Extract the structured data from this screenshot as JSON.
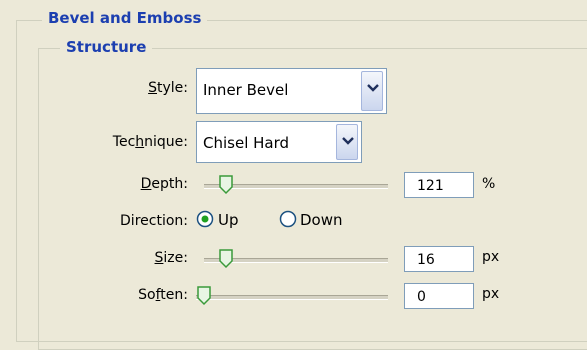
{
  "panel": {
    "title": "Bevel and Emboss",
    "section_title": "Structure"
  },
  "style": {
    "label_pre": "",
    "label_u": "S",
    "label_post": "tyle:",
    "value": "Inner Bevel"
  },
  "technique": {
    "label_pre": "Tec",
    "label_u": "h",
    "label_post": "nique:",
    "value": "Chisel Hard"
  },
  "depth": {
    "label_pre": "",
    "label_u": "D",
    "label_post": "epth:",
    "value": "121",
    "unit": "%",
    "slider_fraction": 0.12
  },
  "direction": {
    "label": "Direction:",
    "options": [
      "Up",
      "Down"
    ],
    "selected": "Up"
  },
  "size": {
    "label_pre": "",
    "label_u": "S",
    "label_post": "ize:",
    "value": "16",
    "unit": "px",
    "slider_fraction": 0.12
  },
  "soften": {
    "label_pre": "So",
    "label_u": "f",
    "label_post": "ten:",
    "value": "0",
    "unit": "px",
    "slider_fraction": 0.0
  },
  "icons": {
    "dropdown": "chevron-down-icon",
    "slider_thumb": "slider-thumb-icon",
    "radio": "radio-button-icon"
  },
  "colors": {
    "background": "#ece9d8",
    "legend": "#1c3fb0",
    "field_border": "#7f9db9",
    "thumb_green": "#3a9a3a"
  }
}
